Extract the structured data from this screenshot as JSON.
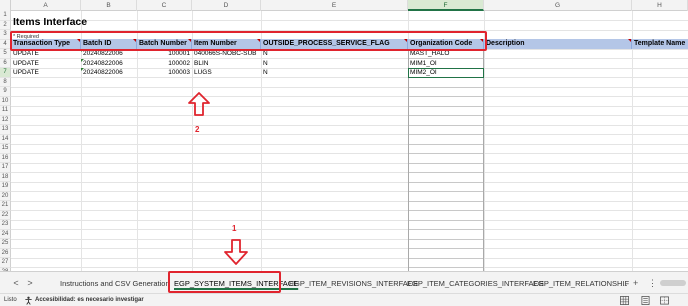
{
  "columns": [
    "A",
    "B",
    "C",
    "D",
    "E",
    "F",
    "G",
    "H"
  ],
  "rows": [
    "1",
    "2",
    "3",
    "4",
    "5",
    "6",
    "7",
    "8",
    "9",
    "10",
    "11",
    "12",
    "13",
    "14",
    "15",
    "16",
    "17",
    "18",
    "19",
    "20",
    "21",
    "22",
    "23",
    "24",
    "25",
    "26",
    "27",
    "28"
  ],
  "sheet_title": "Items Interface",
  "required_note": "* Required",
  "headers": [
    "Transaction Type",
    "Batch ID",
    "Batch Number",
    "Item Number",
    "OUTSIDE_PROCESS_SERVICE_FLAG",
    "Organization Code",
    "Description",
    "Template Name"
  ],
  "data_rows": [
    [
      "UPDATE",
      "20240822006",
      "100001",
      "040066S-NOBC-SUB",
      "N",
      "MAST_HALO"
    ],
    [
      "UPDATE",
      "20240822006",
      "100002",
      "BLIN",
      "N",
      "MIM1_OI"
    ],
    [
      "UPDATE",
      "20240822006",
      "100003",
      "LUGS",
      "N",
      "MIM2_OI"
    ]
  ],
  "annotations": {
    "label_1": "1",
    "label_2": "2"
  },
  "sheet_tabs": [
    "Instructions and CSV Generation",
    "EGP_SYSTEM_ITEMS_INTERFACE",
    "EGP_ITEM_REVISIONS_INTERFACE",
    "EGP_ITEM_CATEGORIES_INTERFACE",
    "EGP_ITEM_RELATIONSHIF"
  ],
  "active_tab": "EGP_SYSTEM_ITEMS_INTERFACE",
  "tab_controls": {
    "prev": "<",
    "next": ">",
    "more": "...",
    "add": "+",
    "menu": "⋮"
  },
  "status_bar": {
    "ready": "Listo",
    "accessibility": "Accesibilidad: es necesario investigar"
  },
  "colors": {
    "header_fill": "#b4c6e7",
    "annotation_red": "#e0242e",
    "excel_green": "#217346"
  }
}
